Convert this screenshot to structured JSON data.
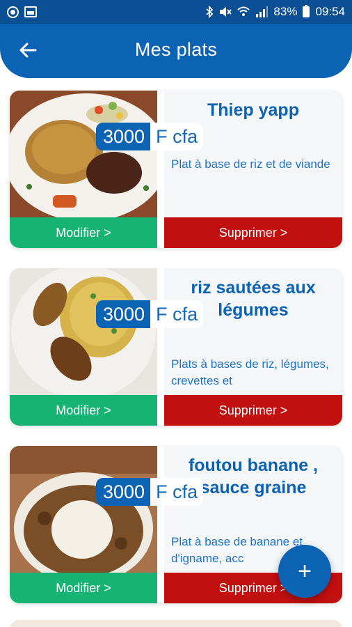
{
  "status_bar": {
    "battery": "83%",
    "time": "09:54",
    "icons": [
      "circle-notification-icon",
      "image-notification-icon",
      "bluetooth-icon",
      "mute-icon",
      "wifi-icon",
      "signal-icon",
      "battery-icon"
    ]
  },
  "app_bar": {
    "title": "Mes plats",
    "back_icon": "arrow-left-icon"
  },
  "dishes": [
    {
      "name": "Thiep yapp",
      "price": "3000",
      "currency": "F cfa",
      "description": "Plat à base de riz et de viande",
      "edit_label": "Modifier >",
      "delete_label": "Supprimer >"
    },
    {
      "name": "riz sautées aux légumes",
      "price": "3000",
      "currency": "F cfa",
      "description": "Plats à bases de riz, légumes, crevettes et",
      "edit_label": "Modifier >",
      "delete_label": "Supprimer >"
    },
    {
      "name": "foutou banane , sauce graine",
      "price": "3000",
      "currency": "F cfa",
      "description": "Plat à base de banane et d'igname, acc",
      "edit_label": "Modifier >",
      "delete_label": "Supprimer >"
    }
  ],
  "fab": {
    "label": "+",
    "icon": "plus-icon"
  },
  "colors": {
    "primary": "#0c62b3",
    "status_bar": "#0a4f94",
    "edit_green": "#17b374",
    "delete_red": "#c20f0f"
  }
}
